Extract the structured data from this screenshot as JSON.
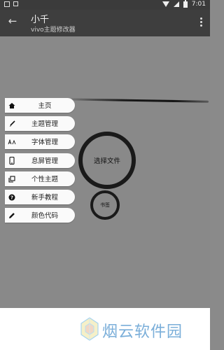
{
  "status_bar": {
    "time": "7:01"
  },
  "app_bar": {
    "title": "小千",
    "subtitle": "vivo主题修改器"
  },
  "menu": {
    "items": [
      {
        "label": "主页",
        "icon": "home-icon"
      },
      {
        "label": "主题管理",
        "icon": "brush-icon"
      },
      {
        "label": "字体管理",
        "icon": "font-icon"
      },
      {
        "label": "息屏管理",
        "icon": "phone-icon"
      },
      {
        "label": "个性主题",
        "icon": "copy-icon"
      },
      {
        "label": "新手教程",
        "icon": "help-icon"
      },
      {
        "label": "颜色代码",
        "icon": "pencil-icon"
      }
    ]
  },
  "actions": {
    "select_file": "选择文件",
    "bookmark": "书签"
  },
  "watermark": {
    "text": "烟云软件园"
  },
  "colors": {
    "background": "#898989",
    "toolbar": "#3e3e3e",
    "menu_item": "#fafafa",
    "circle_border": "#1a1a1a",
    "watermark": "#7aaed9"
  }
}
